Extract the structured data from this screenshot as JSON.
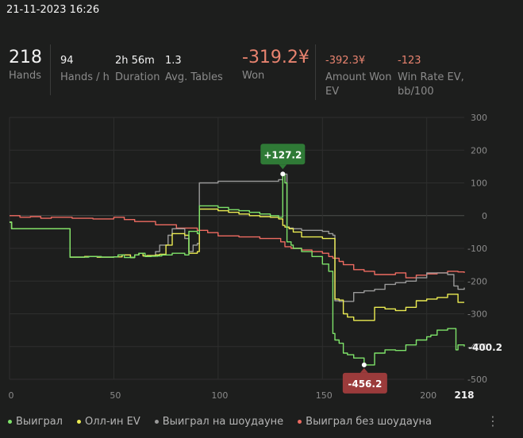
{
  "header": {
    "datetime": "21-11-2023 16:26"
  },
  "stats": {
    "hands": {
      "value": "218",
      "label": "Hands"
    },
    "hands_per_hour": {
      "value": "94",
      "label": "Hands / h"
    },
    "duration": {
      "value": "2h 56m",
      "label": "Duration"
    },
    "avg_tables": {
      "value": "1.3",
      "label": "Avg. Tables"
    },
    "won": {
      "value": "-319.2¥",
      "label": "Won"
    },
    "amount_won_ev": {
      "value": "-392.3¥",
      "label1": "Amount Won",
      "label2": "EV"
    },
    "win_rate_ev": {
      "value": "-123",
      "label1": "Win Rate EV,",
      "label2": "bb/100"
    }
  },
  "colors": {
    "green": "#7ee36a",
    "yellow": "#ecec52",
    "gray": "#9a9a9a",
    "red": "#ee6b61",
    "max_badge": "#2f7a36",
    "min_badge": "#9b3b3b"
  },
  "chart_data": {
    "type": "line",
    "x_ticks": [
      "0",
      "50",
      "100",
      "150",
      "200",
      "218"
    ],
    "y_ticks": [
      "300",
      "200",
      "100",
      "0",
      "-100",
      "-200",
      "-300",
      "-400",
      "-500"
    ],
    "xlim": [
      0,
      218
    ],
    "ylim": [
      -500,
      300
    ],
    "max_label": "+127.2",
    "min_label": "-456.2",
    "end_label": "-400.2",
    "series": [
      {
        "name": "Выиграл",
        "color_key": "green",
        "x": [
          0,
          1,
          25,
          29,
          38,
          44,
          50,
          52,
          55,
          60,
          62,
          65,
          68,
          71,
          73,
          78,
          84,
          86,
          90,
          91,
          100,
          105,
          110,
          115,
          120,
          125,
          129,
          131,
          132,
          133,
          134,
          135,
          136,
          140,
          145,
          150,
          153,
          155,
          156,
          158,
          160,
          162,
          165,
          170,
          175,
          180,
          185,
          190,
          195,
          200,
          202,
          205,
          210,
          214,
          215,
          218
        ],
        "y": [
          -20,
          -40,
          -40,
          -127,
          -125,
          -127,
          -126,
          -120,
          -128,
          -120,
          -115,
          -125,
          -124,
          -123,
          -120,
          -115,
          -120,
          -48,
          -55,
          30,
          25,
          18,
          15,
          10,
          5,
          0,
          -5,
          127.2,
          100,
          -80,
          -80,
          -90,
          -100,
          -110,
          -125,
          -148,
          -170,
          -360,
          -380,
          -390,
          -420,
          -425,
          -435,
          -456.2,
          -420,
          -410,
          -412,
          -395,
          -380,
          -370,
          -365,
          -350,
          -345,
          -410,
          -395,
          -400.2
        ]
      },
      {
        "name": "Олл-ин EV",
        "color_key": "yellow",
        "x": [
          0,
          1,
          25,
          29,
          36,
          42,
          50,
          54,
          58,
          60,
          62,
          64,
          66,
          70,
          72,
          75,
          78,
          84,
          86,
          90,
          91,
          100,
          105,
          110,
          115,
          120,
          125,
          129,
          131,
          132,
          133,
          134,
          136,
          140,
          145,
          150,
          153,
          155,
          156,
          158,
          160,
          162,
          165,
          168,
          172,
          175,
          180,
          185,
          190,
          195,
          200,
          205,
          210,
          215,
          218
        ],
        "y": [
          -20,
          -40,
          -40,
          -127,
          -125,
          -127,
          -126,
          -120,
          -128,
          -120,
          -115,
          -123,
          -122,
          -120,
          -118,
          -90,
          -55,
          -60,
          -115,
          -110,
          20,
          15,
          10,
          5,
          0,
          -3,
          -5,
          -10,
          -30,
          -35,
          -35,
          -40,
          -50,
          -65,
          -65,
          -70,
          -70,
          -70,
          -255,
          -258,
          -300,
          -310,
          -320,
          -320,
          -320,
          -280,
          -285,
          -290,
          -280,
          -260,
          -255,
          -250,
          -240,
          -265,
          -265
        ]
      },
      {
        "name": "Выиграл на шоудауне",
        "color_key": "gray",
        "x": [
          0,
          1,
          25,
          29,
          36,
          42,
          50,
          54,
          58,
          60,
          62,
          64,
          66,
          70,
          72,
          76,
          78,
          84,
          86,
          88,
          90,
          91,
          100,
          110,
          120,
          129,
          131,
          132,
          133,
          134,
          136,
          140,
          145,
          150,
          153,
          155,
          156,
          158,
          160,
          162,
          165,
          170,
          175,
          180,
          185,
          190,
          195,
          200,
          205,
          210,
          213,
          215,
          218
        ],
        "y": [
          -20,
          -40,
          -40,
          -127,
          -125,
          -127,
          -126,
          -120,
          -128,
          -120,
          -115,
          -123,
          -122,
          -110,
          -90,
          -60,
          -40,
          -70,
          -110,
          -90,
          -85,
          100,
          105,
          105,
          105,
          110,
          125,
          127,
          -35,
          -38,
          -40,
          -45,
          -45,
          -48,
          -55,
          -60,
          -260,
          -262,
          -262,
          -262,
          -235,
          -230,
          -225,
          -210,
          -205,
          -200,
          -190,
          -175,
          -175,
          -180,
          -215,
          -225,
          -220
        ]
      },
      {
        "name": "Выиграл без шоудауна",
        "color_key": "red",
        "x": [
          0,
          5,
          10,
          15,
          20,
          25,
          30,
          40,
          50,
          55,
          60,
          70,
          80,
          90,
          95,
          100,
          110,
          120,
          130,
          132,
          135,
          140,
          145,
          150,
          153,
          155,
          158,
          160,
          165,
          170,
          175,
          180,
          185,
          190,
          195,
          200,
          205,
          210,
          215,
          218
        ],
        "y": [
          0,
          -5,
          -3,
          -8,
          -5,
          -5,
          -8,
          -10,
          -5,
          -12,
          -18,
          -28,
          -38,
          -45,
          -52,
          -62,
          -65,
          -70,
          -80,
          -95,
          -100,
          -105,
          -110,
          -115,
          -125,
          -130,
          -140,
          -150,
          -165,
          -170,
          -180,
          -180,
          -175,
          -190,
          -182,
          -178,
          -175,
          -170,
          -172,
          -175
        ]
      }
    ]
  }
}
